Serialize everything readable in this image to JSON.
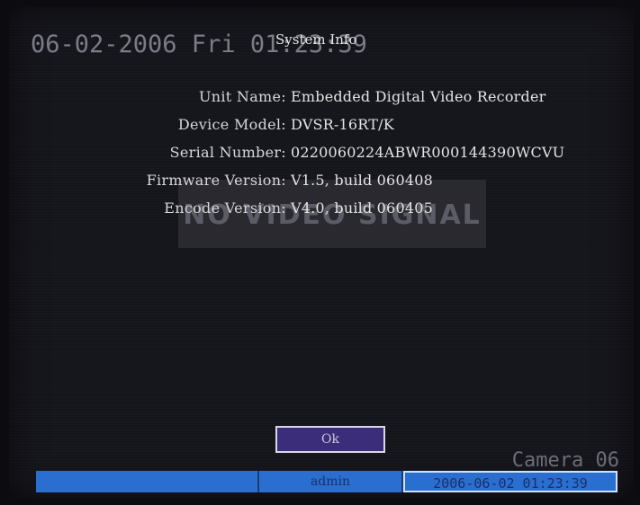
{
  "osd": {
    "clock": "06-02-2006 Fri 01:23:39",
    "camera": "Camera 06"
  },
  "dialog": {
    "title": "System Info",
    "ok_label": "Ok"
  },
  "info": [
    {
      "label": "Unit Name:",
      "value": "Embedded Digital Video Recorder"
    },
    {
      "label": "Device Model:",
      "value": "DVSR-16RT/K"
    },
    {
      "label": "Serial Number:",
      "value": "0220060224ABWR000144390WCVU"
    },
    {
      "label": "Firmware Version:",
      "value": "V1.5, build 060408"
    },
    {
      "label": "Encode Version:",
      "value": "V4.0, build 060405"
    }
  ],
  "overlay": {
    "no_video": "NO VIDEO SIGNAL"
  },
  "status_bar": {
    "user": "admin",
    "datetime": "2006-06-02 01:23:39"
  }
}
